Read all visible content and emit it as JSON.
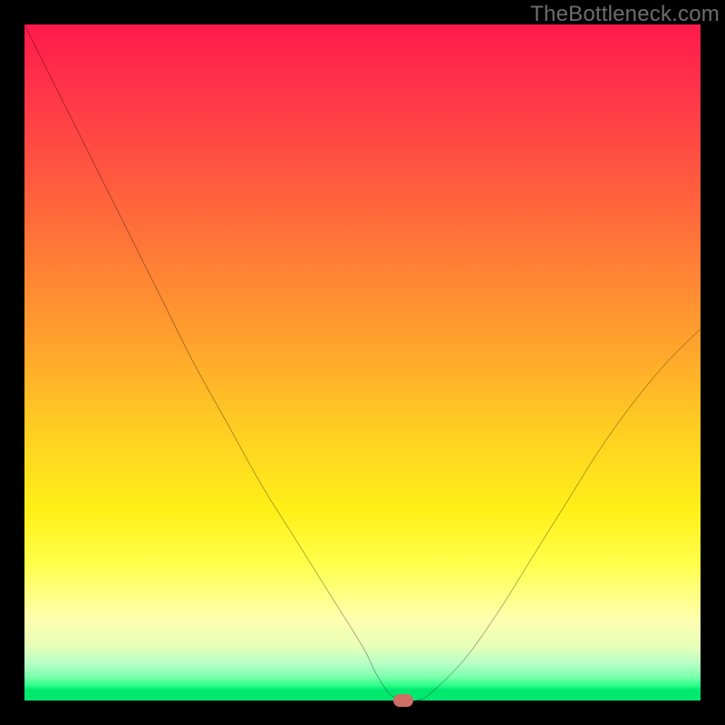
{
  "watermark": "TheBottleneck.com",
  "chart_data": {
    "type": "line",
    "title": "",
    "xlabel": "",
    "ylabel": "",
    "xlim": [
      0,
      100
    ],
    "ylim": [
      0,
      100
    ],
    "series": [
      {
        "name": "bottleneck-curve",
        "x": [
          0,
          5,
          10,
          15,
          20,
          25,
          30,
          35,
          40,
          45,
          50,
          52,
          54,
          56,
          58,
          60,
          65,
          70,
          75,
          80,
          85,
          90,
          95,
          100
        ],
        "values": [
          100,
          90,
          80,
          70,
          60,
          50,
          41,
          32,
          24,
          16,
          8,
          4,
          1,
          0,
          0,
          1,
          6,
          13,
          21,
          29,
          37,
          44,
          50,
          55
        ]
      }
    ],
    "marker": {
      "x": 56,
      "y": 0,
      "color": "#cf6e64"
    },
    "background_gradient": {
      "stops": [
        {
          "pos": 0,
          "color": "#ff1a4b"
        },
        {
          "pos": 0.35,
          "color": "#ff7e36"
        },
        {
          "pos": 0.6,
          "color": "#ffce22"
        },
        {
          "pos": 0.88,
          "color": "#ffffb0"
        },
        {
          "pos": 0.97,
          "color": "#2cff88"
        },
        {
          "pos": 1.0,
          "color": "#00e96f"
        }
      ]
    }
  }
}
